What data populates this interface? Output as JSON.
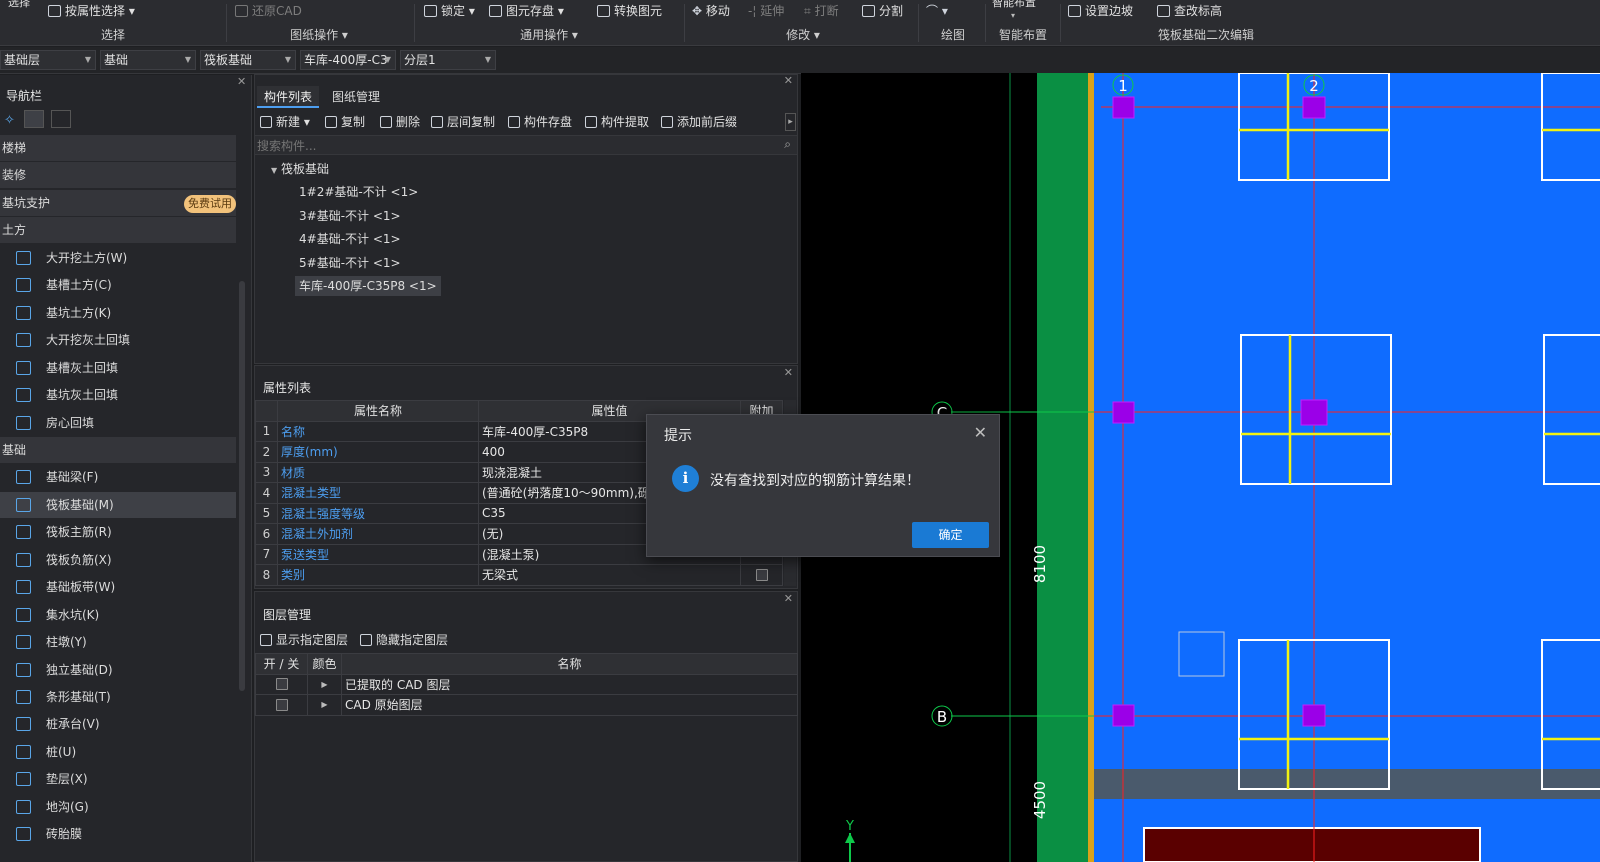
{
  "ribbon": {
    "top_buttons": [
      {
        "label": "选择",
        "icon": "select-icon",
        "enabled": true
      },
      {
        "label": "按属性选择",
        "icon": "filter-select-icon",
        "enabled": true
      },
      {
        "label": "还原CAD",
        "icon": "restore-cad-icon",
        "enabled": false
      },
      {
        "label": "锁定",
        "icon": "lock-icon",
        "enabled": true
      },
      {
        "label": "图元存盘",
        "icon": "save-element-icon",
        "enabled": true
      },
      {
        "label": "转换图元",
        "icon": "convert-element-icon",
        "enabled": true
      },
      {
        "label": "移动",
        "icon": "move-icon",
        "enabled": true
      },
      {
        "label": "延伸",
        "icon": "extend-icon",
        "enabled": false
      },
      {
        "label": "打断",
        "icon": "break-icon",
        "enabled": false
      },
      {
        "label": "分割",
        "icon": "split-icon",
        "enabled": true
      },
      {
        "label": "智能布置",
        "icon": "smart-layout-icon",
        "enabled": true
      },
      {
        "label": "设置边坡",
        "icon": "slope-icon",
        "enabled": true
      },
      {
        "label": "查改标高",
        "icon": "elevation-icon",
        "enabled": true
      }
    ],
    "groups": [
      "选择",
      "图纸操作",
      "通用操作",
      "修改",
      "绘图",
      "智能布置",
      "筏板基础二次编辑"
    ]
  },
  "selectors": [
    "基础层",
    "基础",
    "筏板基础",
    "车库-400厚-C3",
    "分层1"
  ],
  "nav": {
    "title": "导航栏",
    "badge": "免费试用",
    "items": [
      {
        "label": "楼梯",
        "type": "category"
      },
      {
        "label": "装修",
        "type": "category"
      },
      {
        "label": "基坑支护",
        "type": "category"
      },
      {
        "label": "土方",
        "type": "category"
      },
      {
        "label": "大开挖土方(W)",
        "type": "item"
      },
      {
        "label": "基槽土方(C)",
        "type": "item"
      },
      {
        "label": "基坑土方(K)",
        "type": "item"
      },
      {
        "label": "大开挖灰土回填",
        "type": "item"
      },
      {
        "label": "基槽灰土回填",
        "type": "item"
      },
      {
        "label": "基坑灰土回填",
        "type": "item"
      },
      {
        "label": "房心回填",
        "type": "item"
      },
      {
        "label": "基础",
        "type": "category"
      },
      {
        "label": "基础梁(F)",
        "type": "item"
      },
      {
        "label": "筏板基础(M)",
        "type": "item",
        "active": true
      },
      {
        "label": "筏板主筋(R)",
        "type": "item"
      },
      {
        "label": "筏板负筋(X)",
        "type": "item"
      },
      {
        "label": "基础板带(W)",
        "type": "item"
      },
      {
        "label": "集水坑(K)",
        "type": "item"
      },
      {
        "label": "柱墩(Y)",
        "type": "item"
      },
      {
        "label": "独立基础(D)",
        "type": "item"
      },
      {
        "label": "条形基础(T)",
        "type": "item"
      },
      {
        "label": "桩承台(V)",
        "type": "item"
      },
      {
        "label": "桩(U)",
        "type": "item"
      },
      {
        "label": "垫层(X)",
        "type": "item"
      },
      {
        "label": "地沟(G)",
        "type": "item"
      },
      {
        "label": "砖胎膜",
        "type": "item"
      }
    ]
  },
  "component_panel": {
    "tabs": [
      "构件列表",
      "图纸管理"
    ],
    "toolbar": [
      "新建",
      "复制",
      "删除",
      "层间复制",
      "构件存盘",
      "构件提取",
      "添加前后缀"
    ],
    "search_placeholder": "搜索构件...",
    "tree_root": "筏板基础",
    "tree_items": [
      "1#2#基础-不计 <1>",
      "3#基础-不计 <1>",
      "4#基础-不计 <1>",
      "5#基础-不计 <1>",
      "车库-400厚-C35P8 <1>"
    ],
    "selected_index": 4
  },
  "property_panel": {
    "title": "属性列表",
    "headers": [
      "属性名称",
      "属性值",
      "附加"
    ],
    "rows": [
      {
        "no": "1",
        "name": "名称",
        "value": "车库-400厚-C35P8",
        "check": false
      },
      {
        "no": "2",
        "name": "厚度(mm)",
        "value": "400",
        "check": false
      },
      {
        "no": "3",
        "name": "材质",
        "value": "现浇混凝土",
        "check": false
      },
      {
        "no": "4",
        "name": "混凝土类型",
        "value": "(普通砼(坍落度10～90mm),砾石",
        "check": false
      },
      {
        "no": "5",
        "name": "混凝土强度等级",
        "value": "C35",
        "check": false
      },
      {
        "no": "6",
        "name": "混凝土外加剂",
        "value": "(无)",
        "check": false
      },
      {
        "no": "7",
        "name": "泵送类型",
        "value": "(混凝土泵)",
        "check": false
      },
      {
        "no": "8",
        "name": "类别",
        "value": "无梁式",
        "check": true
      }
    ]
  },
  "layer_panel": {
    "title": "图层管理",
    "buttons": [
      "显示指定图层",
      "隐藏指定图层"
    ],
    "headers": [
      "开 / 关",
      "颜色",
      "名称"
    ],
    "rows": [
      "已提取的 CAD 图层",
      "CAD 原始图层"
    ]
  },
  "canvas": {
    "axis_labels": [
      "1",
      "2",
      "C",
      "B"
    ],
    "dimensions": [
      "8100",
      "4500"
    ],
    "ucs_label": "Y",
    "colors": {
      "slab": "#0f6cff",
      "wall": "#0a8f43",
      "gridline": "#ff1f1f",
      "footing": "#ffffff",
      "column": "#9b00e8",
      "strip": "#f2f212"
    }
  },
  "dialog": {
    "title": "提示",
    "message": "没有查找到对应的钢筋计算结果！",
    "ok_label": "确定"
  }
}
